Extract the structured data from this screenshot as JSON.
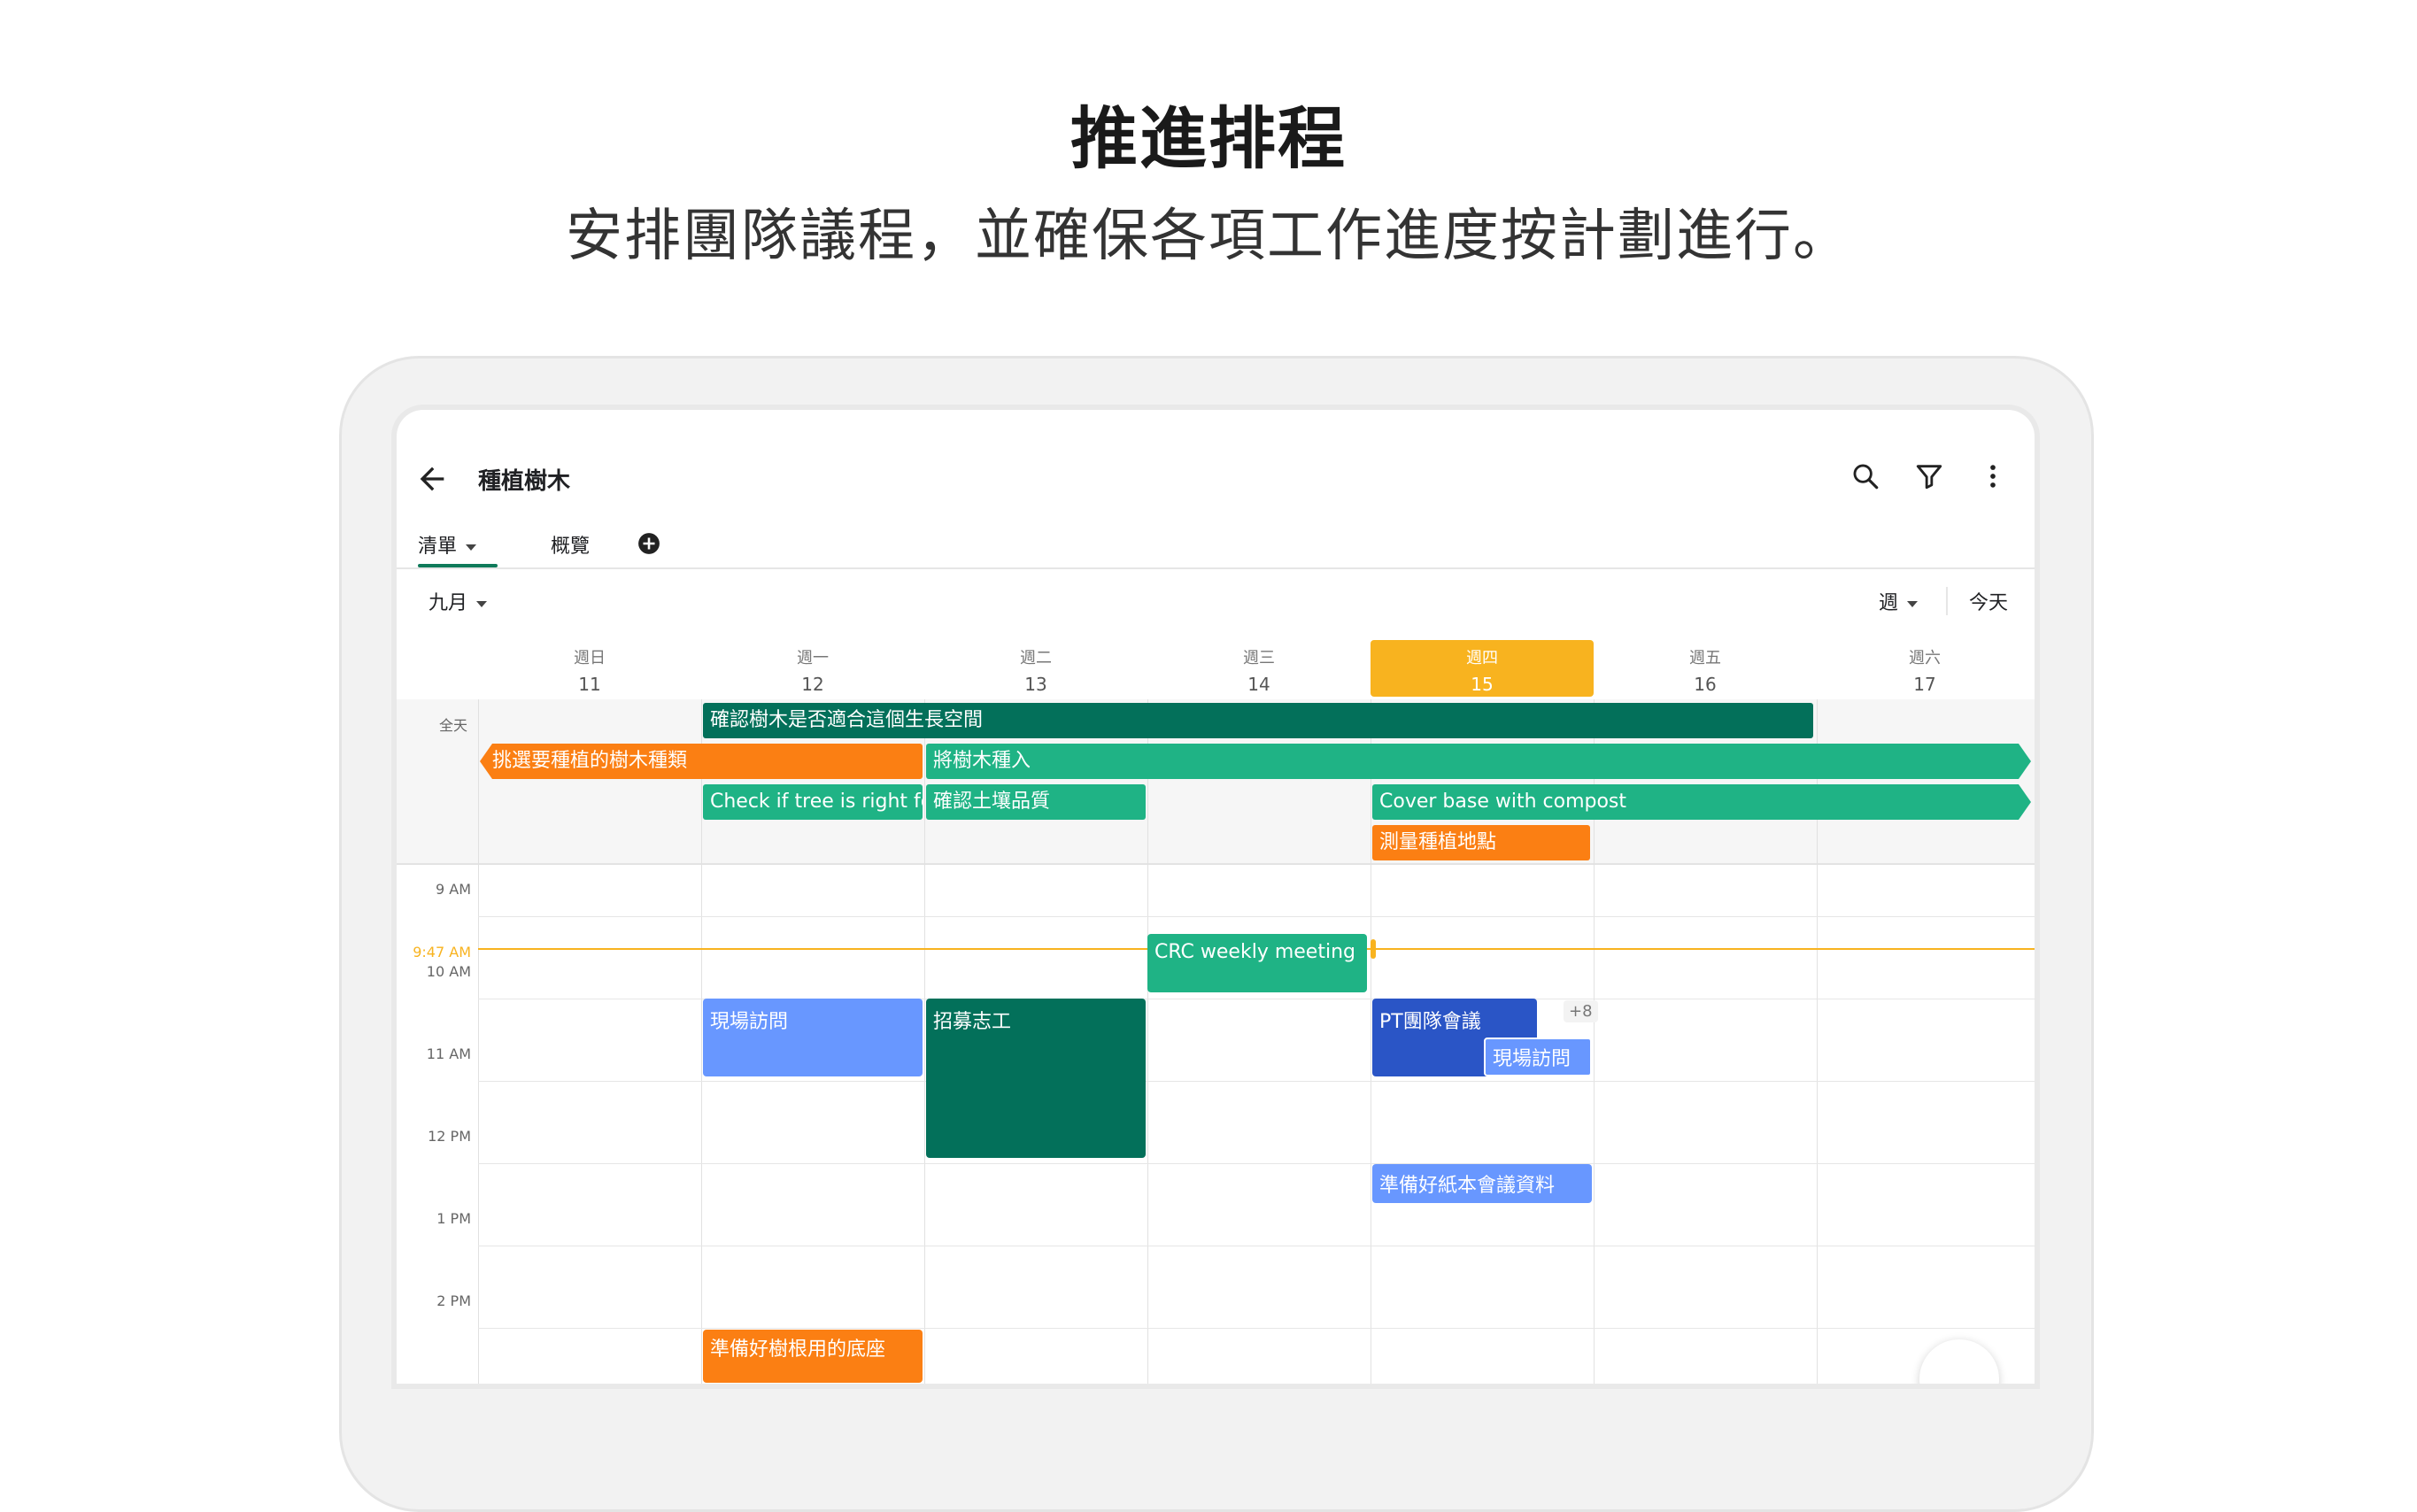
{
  "hero": {
    "title": "推進排程",
    "subtitle": "安排團隊議程，並確保各項工作進度按計劃進行。"
  },
  "app": {
    "project_title": "種植樹木",
    "tabs": [
      {
        "label": "清單",
        "active": true
      },
      {
        "label": "概覽",
        "active": false
      }
    ],
    "month_select": "九月",
    "view_select": "週",
    "today_button": "今天",
    "icons": [
      "back-arrow-icon",
      "search-icon",
      "filter-icon",
      "more-vert-icon",
      "add-circle-icon"
    ]
  },
  "calendar": {
    "days": [
      {
        "dow": "週日",
        "num": "11",
        "today": false
      },
      {
        "dow": "週一",
        "num": "12",
        "today": false
      },
      {
        "dow": "週二",
        "num": "13",
        "today": false
      },
      {
        "dow": "週三",
        "num": "14",
        "today": false
      },
      {
        "dow": "週四",
        "num": "15",
        "today": true
      },
      {
        "dow": "週五",
        "num": "16",
        "today": false
      },
      {
        "dow": "週六",
        "num": "17",
        "today": false
      }
    ],
    "allday_label": "全天",
    "allday_events": [
      {
        "title": "確認樹木是否適合這個生長空間",
        "color": "#03705a"
      },
      {
        "title": "挑選要種植的樹木種類",
        "color": "#fb7f13"
      },
      {
        "title": "將樹木種入",
        "color": "#1fb385"
      },
      {
        "title": "Check if tree is right fo",
        "color": "#1fb385"
      },
      {
        "title": "確認土壤品質",
        "color": "#1fb385"
      },
      {
        "title": "Cover base with compost",
        "color": "#1fb385"
      },
      {
        "title": "測量種植地點",
        "color": "#fb7f13"
      }
    ],
    "hours": [
      "9 AM",
      "10 AM",
      "11 AM",
      "12 PM",
      "1 PM",
      "2 PM"
    ],
    "now_label": "9:47 AM",
    "events": [
      {
        "title": "CRC weekly meeting",
        "color": "#1fb385"
      },
      {
        "title": "現場訪問",
        "color": "#6897ff"
      },
      {
        "title": "招募志工",
        "color": "#03705a"
      },
      {
        "title": "PT團隊會議",
        "color": "#2a55c6"
      },
      {
        "title": "現場訪問",
        "color": "#6897ff"
      },
      {
        "title": "準備好紙本會議資料",
        "color": "#6897ff"
      },
      {
        "title": "準備好樹根用的底座",
        "color": "#fb7f13"
      }
    ],
    "more_badge": "+8"
  }
}
